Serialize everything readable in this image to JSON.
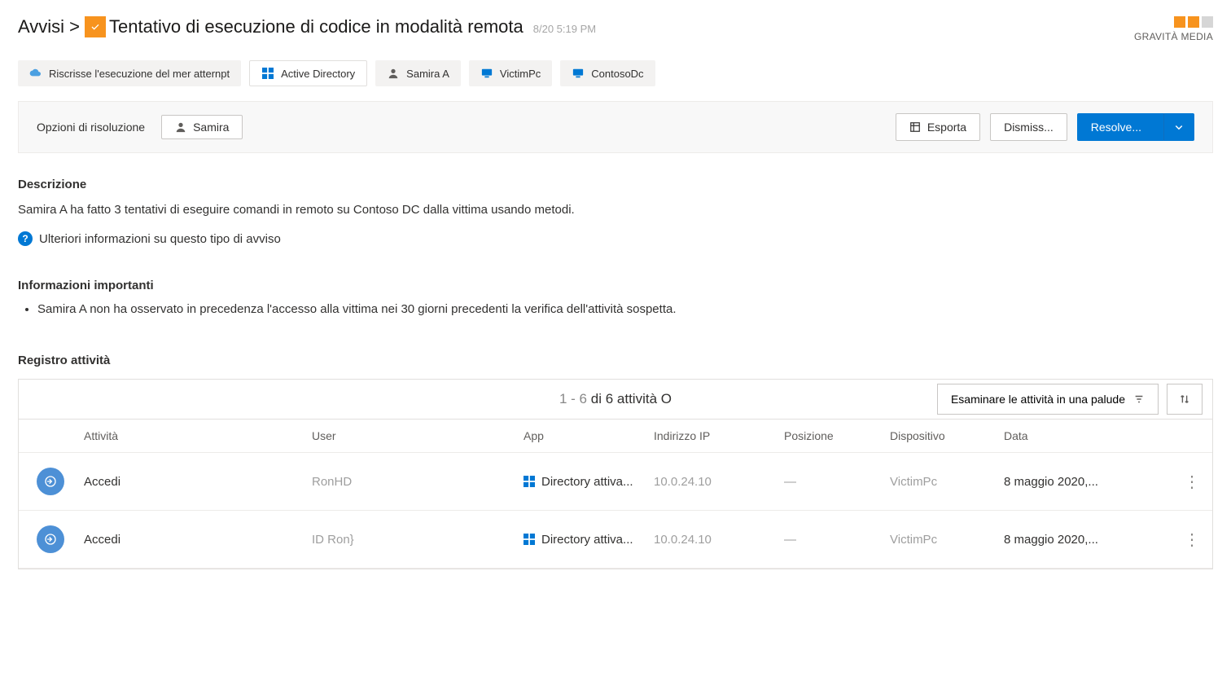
{
  "header": {
    "breadcrumb_prefix": "Avvisi >",
    "title": "Tentativo di esecuzione di codice in modalità remota",
    "timestamp_sub": "8/20 5:19 PM",
    "severity_label": "GRAVITÀ MEDIA"
  },
  "chips": {
    "rescript": "Riscrisse l'esecuzione del mer atternpt",
    "ad": "Active Directory",
    "samira": "Samira A",
    "victimpc": "VictimPc",
    "contosodc": "ContosoDc"
  },
  "resolution": {
    "label": "Opzioni di risoluzione",
    "user": "Samira",
    "export": "Esporta",
    "dismiss": "Dismiss...",
    "resolve": "Resolve..."
  },
  "description": {
    "heading": "Descrizione",
    "text": "Samira A ha fatto 3 tentativi di eseguire comandi in remoto su Contoso DC dalla vittima usando metodi.",
    "info_link": "Ulteriori informazioni su questo tipo di avviso"
  },
  "important": {
    "heading": "Informazioni importanti",
    "item1": "Samira A non ha osservato in precedenza l'accesso alla vittima nei 30 giorni precedenti la verifica dell'attività sospetta."
  },
  "log": {
    "heading": "Registro attività",
    "count_prefix": "1 - 6",
    "count_text": "di 6 attività O",
    "swamp_btn": "Esaminare le attività in una palude",
    "columns": {
      "activity": "Attività",
      "user": "User",
      "app": "App",
      "ip": "Indirizzo IP",
      "position": "Posizione",
      "device": "Dispositivo",
      "date": "Data"
    },
    "rows": [
      {
        "activity": "Accedi",
        "user": "RonHD",
        "app": "Directory attiva...",
        "ip": "10.0.24.10",
        "position": "—",
        "device": "VictimPc",
        "date": "8 maggio 2020,..."
      },
      {
        "activity": "Accedi",
        "user": "ID Ron}",
        "app": "Directory attiva...",
        "ip": "10.0.24.10",
        "position": "—",
        "device": "VictimPc",
        "date": "8 maggio 2020,..."
      }
    ]
  }
}
